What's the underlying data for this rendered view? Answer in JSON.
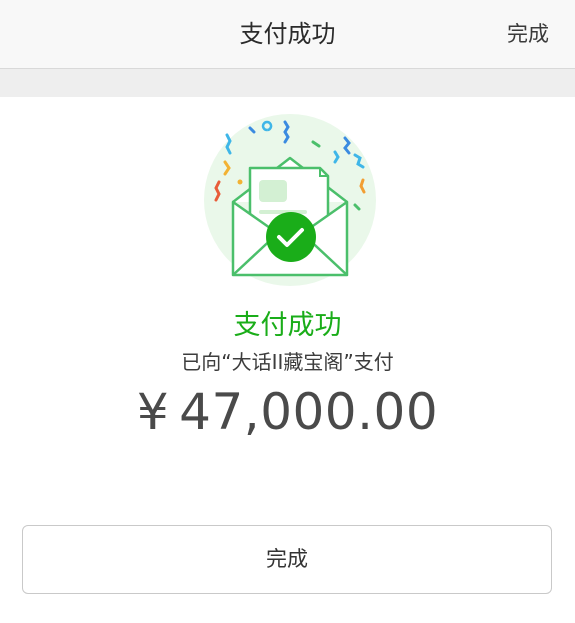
{
  "header": {
    "title": "支付成功",
    "done_label": "完成"
  },
  "result": {
    "status_text": "支付成功",
    "payee_line": "已向“大话II藏宝阁”支付",
    "currency_symbol": "¥",
    "amount": "47,000.00"
  },
  "footer": {
    "done_button_label": "完成"
  },
  "colors": {
    "accent_green": "#1aad19",
    "nav_background": "#f8f8f8"
  },
  "icons": {
    "illustration": "envelope-success-icon",
    "check": "check-icon"
  }
}
